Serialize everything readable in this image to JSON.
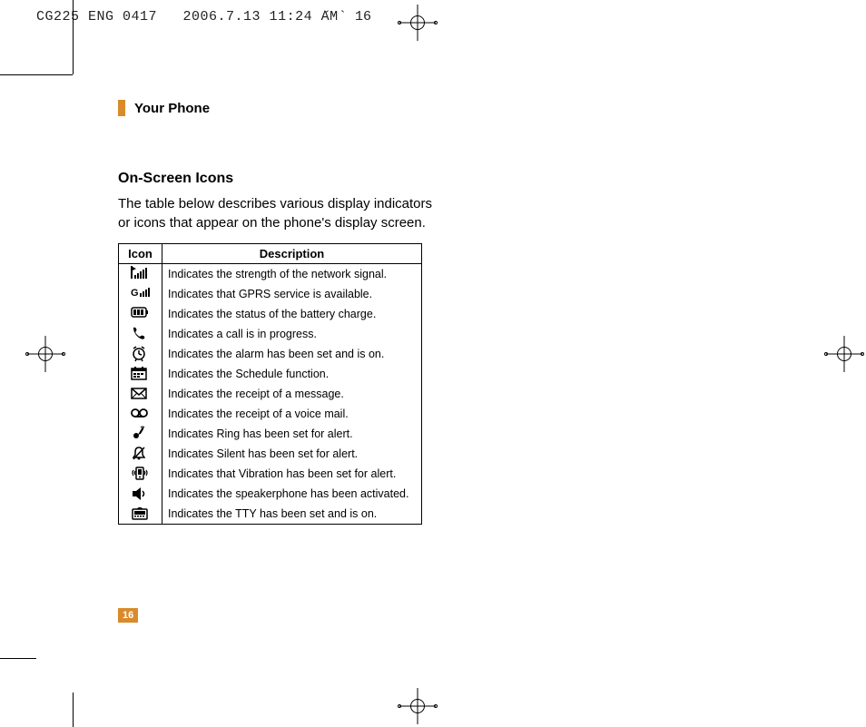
{
  "header": {
    "doc_id": "CG225 ENG 0417",
    "timestamp": "2006.7.13 11:24 AM",
    "page_mark": "˘  ` 16"
  },
  "section": {
    "title": "Your Phone"
  },
  "subsection": {
    "title": "On-Screen Icons",
    "intro_line1": "The table below describes various display indicators",
    "intro_line2": "or icons that appear on the phone's display screen."
  },
  "table": {
    "header_icon": "Icon",
    "header_desc": "Description",
    "rows": [
      {
        "icon_name": "signal-strength-icon",
        "desc": "Indicates the strength of the network signal."
      },
      {
        "icon_name": "gprs-icon",
        "desc": "Indicates that GPRS service is available."
      },
      {
        "icon_name": "battery-icon",
        "desc": "Indicates the status of the battery charge."
      },
      {
        "icon_name": "call-icon",
        "desc": "Indicates a call is in progress."
      },
      {
        "icon_name": "alarm-icon",
        "desc": "Indicates the alarm has been set and is on."
      },
      {
        "icon_name": "schedule-icon",
        "desc": "Indicates the Schedule function."
      },
      {
        "icon_name": "message-icon",
        "desc": "Indicates the receipt of a message."
      },
      {
        "icon_name": "voicemail-icon",
        "desc": "Indicates the receipt of a voice mail."
      },
      {
        "icon_name": "ring-alert-icon",
        "desc": "Indicates Ring has been set for alert."
      },
      {
        "icon_name": "silent-alert-icon",
        "desc": "Indicates Silent has been set for alert."
      },
      {
        "icon_name": "vibration-alert-icon",
        "desc": "Indicates that Vibration has been set for alert."
      },
      {
        "icon_name": "speakerphone-icon",
        "desc": "Indicates the speakerphone has been activated."
      },
      {
        "icon_name": "tty-icon",
        "desc": "Indicates the TTY has been set and is on."
      }
    ]
  },
  "page_number": "16"
}
